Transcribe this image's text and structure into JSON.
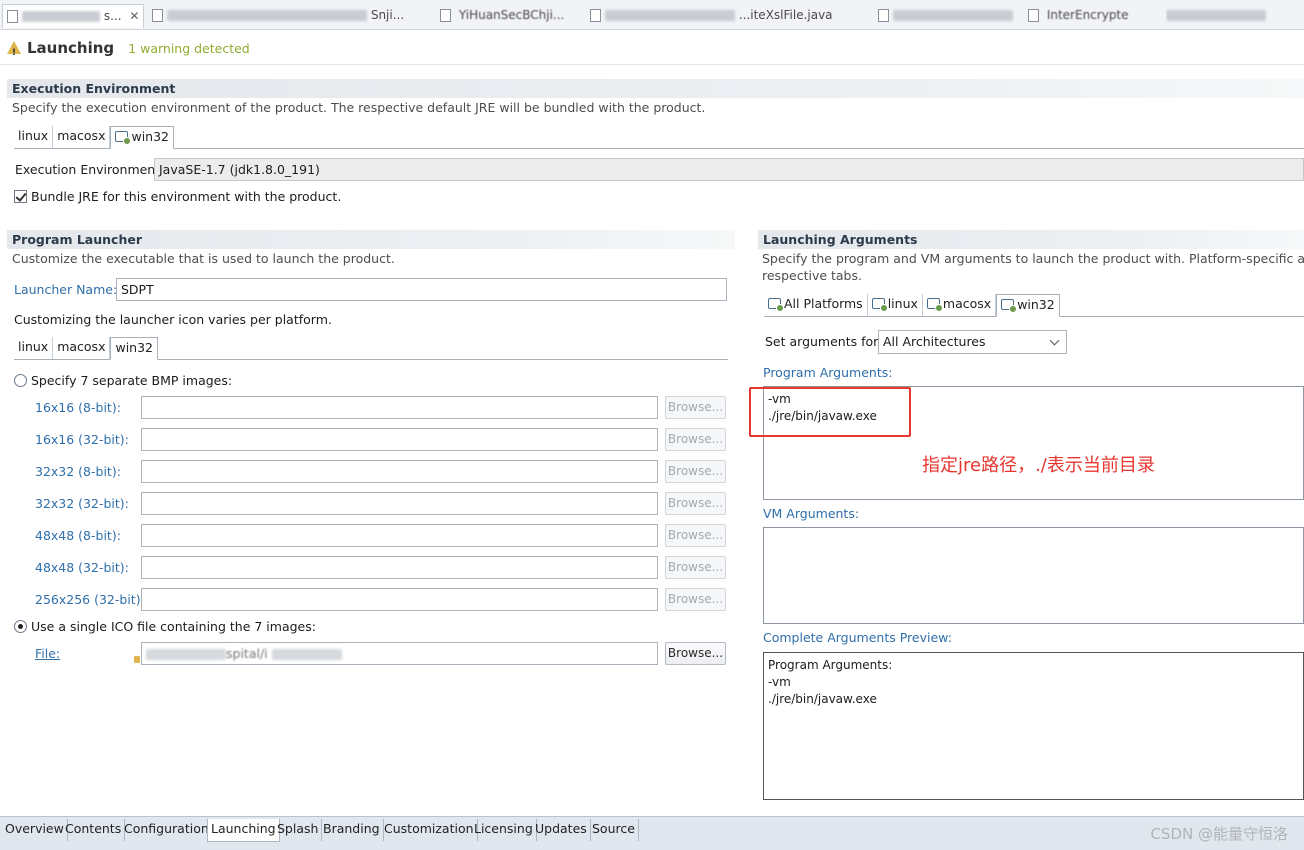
{
  "editor_tabs": [
    {
      "label": "s...",
      "close": "✕",
      "active": true
    },
    {
      "label": "Snji..."
    },
    {
      "label": "YiHuanSecBChji..."
    },
    {
      "label": "...iteXslFile.java"
    },
    {
      "label": "InterEncrypte"
    }
  ],
  "form": {
    "title": "Launching",
    "warning": "1 warning detected"
  },
  "execution_env": {
    "header": "Execution Environment",
    "description": "Specify the execution environment of the product. The respective default JRE will be bundled with the product.",
    "tabs": [
      "linux",
      "macosx",
      "win32"
    ],
    "env_label": "Execution Environment:",
    "env_value": "JavaSE-1.7 (jdk1.8.0_191)",
    "bundle_label": "Bundle JRE for this environment with the product."
  },
  "program_launcher": {
    "header": "Program Launcher",
    "description": "Customize the executable that is used to launch the product.",
    "launcher_name_label": "Launcher Name:",
    "launcher_name_value": "SDPT",
    "icon_note": "Customizing the launcher icon varies per platform.",
    "tabs": [
      "linux",
      "macosx",
      "win32"
    ],
    "bmp_radio_label": "Specify 7 separate BMP images:",
    "bmp_rows": [
      {
        "label": "16x16 (8-bit):"
      },
      {
        "label": "16x16 (32-bit):"
      },
      {
        "label": "32x32 (8-bit):"
      },
      {
        "label": "32x32 (32-bit):"
      },
      {
        "label": "48x48 (8-bit):"
      },
      {
        "label": "48x48 (32-bit):"
      },
      {
        "label": "256x256 (32-bit):"
      }
    ],
    "browse_label": "Browse...",
    "ico_radio_label": "Use a single ICO file containing the 7 images:",
    "file_label": "File:",
    "file_value_visible": "spital/i"
  },
  "launching_args": {
    "header": "Launching Arguments",
    "description_line1": "Specify the program and VM arguments to launch the product with.  Platform-specific argum",
    "description_line2": "respective tabs.",
    "tabs": [
      "All Platforms",
      "linux",
      "macosx",
      "win32"
    ],
    "set_args_label": "Set arguments for:",
    "set_args_value": "All Architectures",
    "program_args_label": "Program Arguments:",
    "program_args_value": "-vm\n./jre/bin/javaw.exe",
    "annotation": "指定jre路径，./表示当前目录",
    "vm_args_label": "VM Arguments:",
    "vm_args_value": "",
    "preview_label": "Complete Arguments Preview:",
    "preview_value": "Program Arguments:\n-vm\n./jre/bin/javaw.exe"
  },
  "bottom_tabs": [
    "Overview",
    "Contents",
    "Configuration",
    "Launching",
    "Splash",
    "Branding",
    "Customization",
    "Licensing",
    "Updates",
    "Source"
  ],
  "watermark": "CSDN @能量守恒洛",
  "colors": {
    "link": "#2f6fab",
    "warning": "#8fae32",
    "annotation": "#e8362f"
  }
}
